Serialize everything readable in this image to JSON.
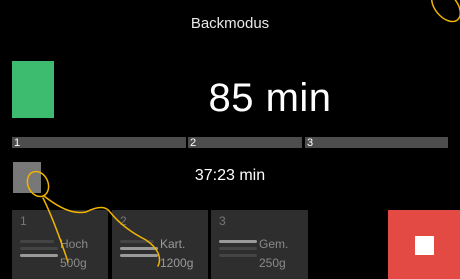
{
  "header": {
    "title": "Backmodus"
  },
  "timer": {
    "total": "85 min",
    "elapsed": "37:23 min"
  },
  "segments": [
    {
      "label": "1"
    },
    {
      "label": "2"
    },
    {
      "label": "3"
    }
  ],
  "programs": [
    {
      "number": "1",
      "name": "Hoch",
      "weight": "500g"
    },
    {
      "number": "2",
      "name": "Kart.",
      "weight": "1200g"
    },
    {
      "number": "3",
      "name": "Gem.",
      "weight": "250g"
    }
  ],
  "colors": {
    "phase_active": "#3dbb6f",
    "stop_button": "#e34a44",
    "gesture_trace": "#f0b400"
  },
  "icons": {
    "stop": "stop-square-icon"
  }
}
